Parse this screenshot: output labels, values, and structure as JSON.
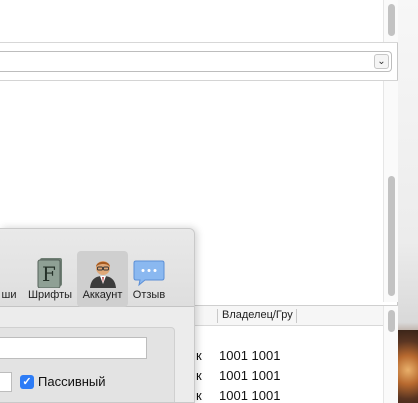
{
  "table": {
    "columns": {
      "owner_group": "Владелец/Гру"
    },
    "rows": [
      {
        "left_fragment": "к",
        "owner_group": "1001 1001"
      },
      {
        "left_fragment": "к",
        "owner_group": "1001 1001"
      },
      {
        "left_fragment": "к",
        "owner_group": "1001 1001"
      }
    ]
  },
  "prefs": {
    "toolbar": [
      {
        "label": "ши",
        "icon": "partial-icon"
      },
      {
        "label": "Шрифты",
        "icon": "fonts-icon"
      },
      {
        "label": "Аккаунт",
        "icon": "account-avatar-icon",
        "selected": true
      },
      {
        "label": "Отзыв",
        "icon": "feedback-bubble-icon"
      }
    ],
    "passive_label": "Пассивный",
    "passive_checked": true
  }
}
